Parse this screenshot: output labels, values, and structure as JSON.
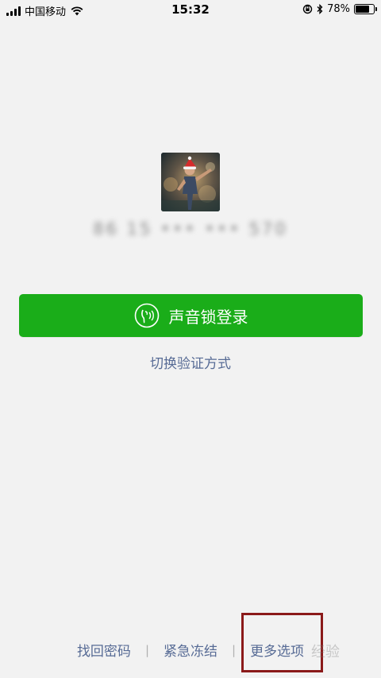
{
  "status_bar": {
    "carrier": "中国移动",
    "time": "15:32",
    "battery_percent_label": "78%",
    "battery_level": 0.78,
    "icons": [
      "signal-icon",
      "wifi-icon",
      "orientation-lock-icon",
      "bluetooth-icon",
      "battery-icon"
    ]
  },
  "profile": {
    "account_masked": "86 15 ••• ••• 570"
  },
  "login": {
    "voice_login_label": "声音锁登录",
    "switch_method_label": "切换验证方式",
    "accent_color": "#1aad19",
    "link_color": "#576b95"
  },
  "bottom": {
    "find_password": "找回密码",
    "emergency_freeze": "紧急冻结",
    "more_options": "更多选项"
  },
  "watermark": "经验"
}
